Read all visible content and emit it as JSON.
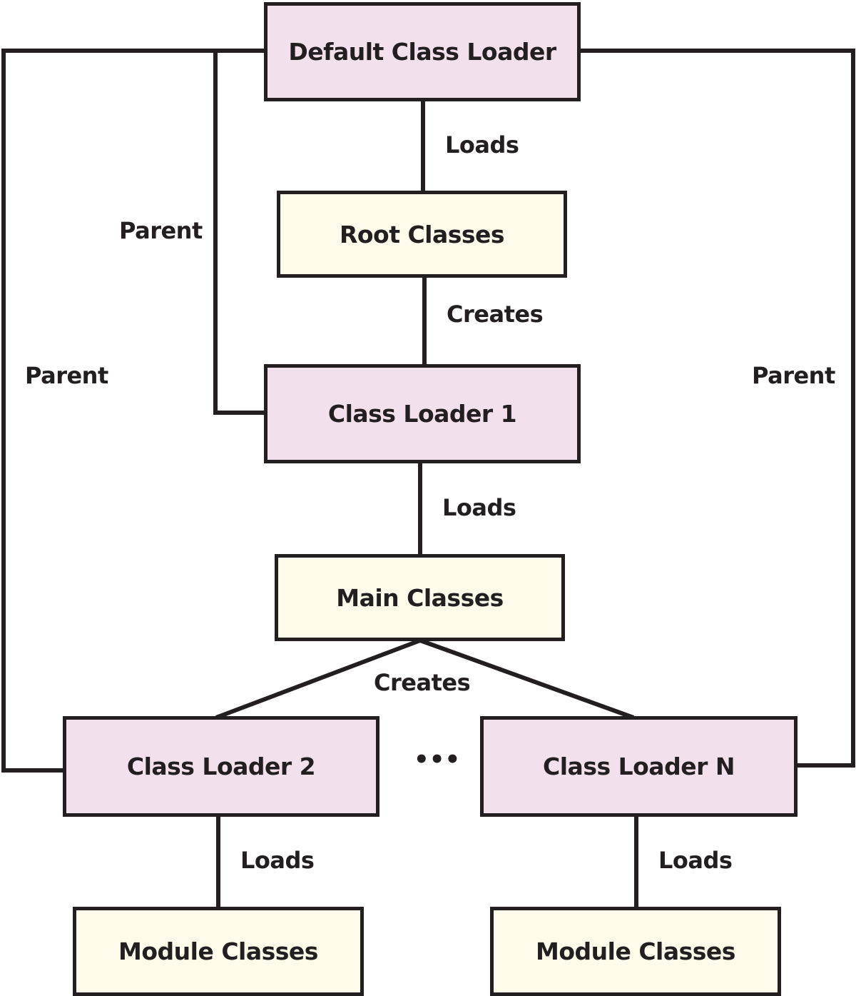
{
  "diagram": {
    "colors": {
      "loader_fill": "#f3e0ed",
      "classes_fill": "#fefbea",
      "stroke": "#231f20"
    },
    "nodes": {
      "default_loader": "Default Class Loader",
      "root_classes": "Root Classes",
      "loader_1": "Class Loader 1",
      "main_classes": "Main Classes",
      "loader_2": "Class Loader 2",
      "loader_n": "Class Loader N",
      "module_classes_2": "Module Classes",
      "module_classes_n": "Module Classes"
    },
    "ellipsis": "•••",
    "edges": {
      "default_loads_root": "Loads",
      "root_creates_loader1": "Creates",
      "loader1_loads_main": "Loads",
      "main_creates_loaders": "Creates",
      "loader2_loads_module": "Loads",
      "loadern_loads_module": "Loads",
      "parent_inner": "Parent",
      "parent_left": "Parent",
      "parent_right": "Parent"
    }
  }
}
